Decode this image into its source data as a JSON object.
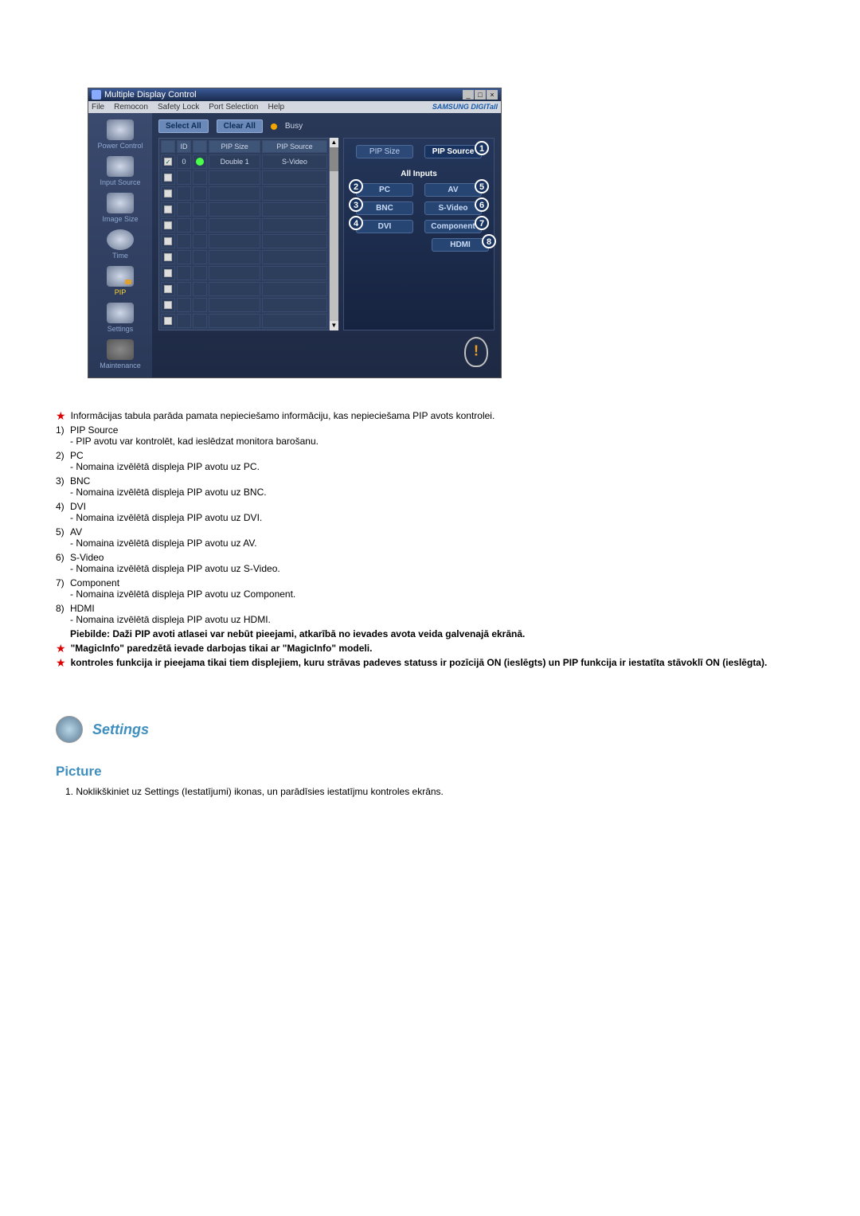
{
  "app": {
    "title": "Multiple Display Control",
    "menus": [
      "File",
      "Remocon",
      "Safety Lock",
      "Port Selection",
      "Help"
    ],
    "brand": "SAMSUNG DIGITall"
  },
  "sidebar": {
    "items": [
      {
        "label": "Power Control"
      },
      {
        "label": "Input Source"
      },
      {
        "label": "Image Size"
      },
      {
        "label": "Time"
      },
      {
        "label": "PIP"
      },
      {
        "label": "Settings"
      },
      {
        "label": "Maintenance"
      }
    ]
  },
  "actions": {
    "select_all": "Select All",
    "clear_all": "Clear All",
    "busy": "Busy"
  },
  "table": {
    "headers": {
      "id": "ID",
      "pip_size": "PIP Size",
      "pip_source": "PIP Source"
    },
    "rows": [
      {
        "checked": true,
        "id": "0",
        "status": "on",
        "pip_size": "Double 1",
        "pip_source": "S-Video"
      },
      {},
      {},
      {},
      {},
      {},
      {},
      {},
      {},
      {},
      {},
      {}
    ]
  },
  "panel": {
    "pip_size_btn": "PIP Size",
    "pip_source_btn": "PIP Source",
    "all_inputs": "All Inputs",
    "inputs": {
      "pc": "PC",
      "bnc": "BNC",
      "dvi": "DVI",
      "av": "AV",
      "svideo": "S-Video",
      "component": "Component",
      "hdmi": "HDMI"
    }
  },
  "text": {
    "info_intro": "Informācijas tabula parāda pamata nepieciešamo informāciju, kas nepieciešama PIP avots kontrolei.",
    "items": [
      {
        "num": "1)",
        "title": "PIP Source",
        "desc": "- PIP avotu var kontrolēt, kad ieslēdzat monitora barošanu."
      },
      {
        "num": "2)",
        "title": "PC",
        "desc": "- Nomaina izvēlētā displeja PIP avotu uz PC."
      },
      {
        "num": "3)",
        "title": "BNC",
        "desc": "- Nomaina izvēlētā displeja PIP avotu uz BNC."
      },
      {
        "num": "4)",
        "title": "DVI",
        "desc": "- Nomaina izvēlētā displeja PIP avotu uz DVI."
      },
      {
        "num": "5)",
        "title": "AV",
        "desc": "- Nomaina izvēlētā displeja PIP avotu uz AV."
      },
      {
        "num": "6)",
        "title": "S-Video",
        "desc": "- Nomaina izvēlētā displeja PIP avotu uz S-Video."
      },
      {
        "num": "7)",
        "title": "Component",
        "desc": "- Nomaina izvēlētā displeja PIP avotu uz Component."
      },
      {
        "num": "8)",
        "title": "HDMI",
        "desc": "- Nomaina izvēlētā displeja PIP avotu uz HDMI."
      }
    ],
    "note": "Piebilde: Daži PIP avoti atlasei var nebūt pieejami, atkarībā no ievades avota veida galvenajā ekrānā.",
    "magic": "\"MagicInfo\" paredzētā ievade darbojas tikai ar \"MagicInfo\" modeli.",
    "ctrl_note": "kontroles funkcija ir pieejama tikai tiem displejiem, kuru strāvas padeves statuss ir pozīcijā ON (ieslēgts) un PIP funkcija ir iestatīta stāvoklī ON (ieslēgta).",
    "settings_h": "Settings",
    "picture_h": "Picture",
    "picture_step1": "Noklikškiniet uz Settings (Iestatījumi) ikonas, un parādīsies iestatījmu kontroles ekrāns."
  }
}
